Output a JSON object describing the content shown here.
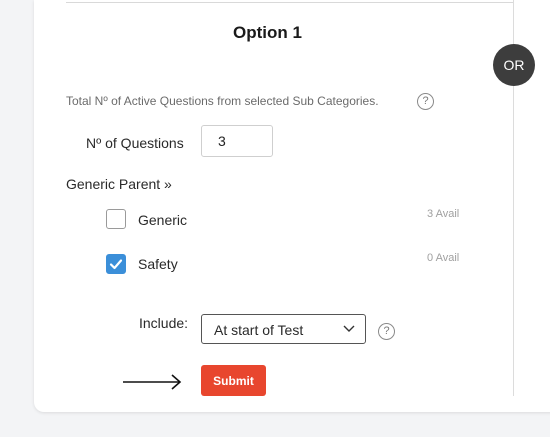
{
  "option": {
    "title": "Option 1",
    "or_label": "OR"
  },
  "total_info": {
    "text": "Total Nº of Active Questions from selected Sub Categories.",
    "help_icon": "question-circle"
  },
  "num_questions": {
    "label": "Nº of Questions",
    "value": "3"
  },
  "generic_parent": {
    "label": "Generic Parent »"
  },
  "categories": [
    {
      "label": "Generic",
      "checked": false,
      "avail": "3 Avail"
    },
    {
      "label": "Safety",
      "checked": true,
      "avail": "0 Avail"
    }
  ],
  "include": {
    "label": "Include:",
    "selected": "At start of Test",
    "help_icon": "question-circle"
  },
  "submit": {
    "label": "Submit",
    "color": "#e8462e"
  },
  "colors": {
    "checkbox_checked": "#3b8fd9",
    "or_badge": "#3d3d3d"
  }
}
